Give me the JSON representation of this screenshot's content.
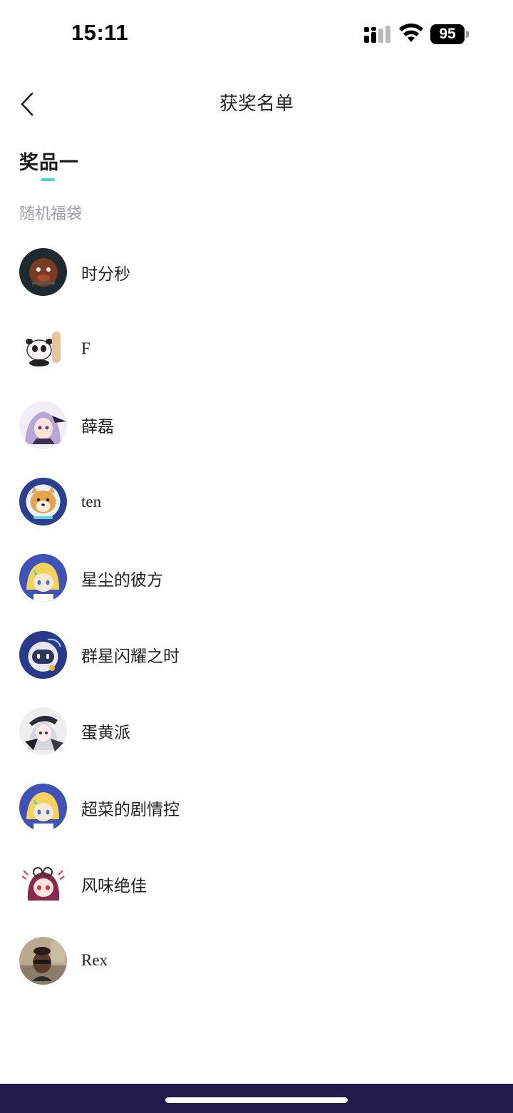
{
  "status_bar": {
    "time": "15:11",
    "battery": "95",
    "icons": [
      "signal-icon",
      "wifi-icon",
      "battery-icon"
    ]
  },
  "nav": {
    "title": "获奖名单",
    "back_icon": "chevron-left-icon"
  },
  "prize": {
    "tab_label": "奖品一",
    "accent_color": "#4fd6c3",
    "name": "随机福袋"
  },
  "winners": [
    {
      "name": "时分秒"
    },
    {
      "name": "F"
    },
    {
      "name": "薛磊"
    },
    {
      "name": "ten"
    },
    {
      "name": "星尘的彼方"
    },
    {
      "name": "群星闪耀之时"
    },
    {
      "name": "蛋黄派"
    },
    {
      "name": "超菜的剧情控"
    },
    {
      "name": "风味绝佳"
    },
    {
      "name": "Rex"
    }
  ],
  "colors": {
    "home_strip": "#221a4a",
    "secondary_text": "#9aa0a6"
  }
}
